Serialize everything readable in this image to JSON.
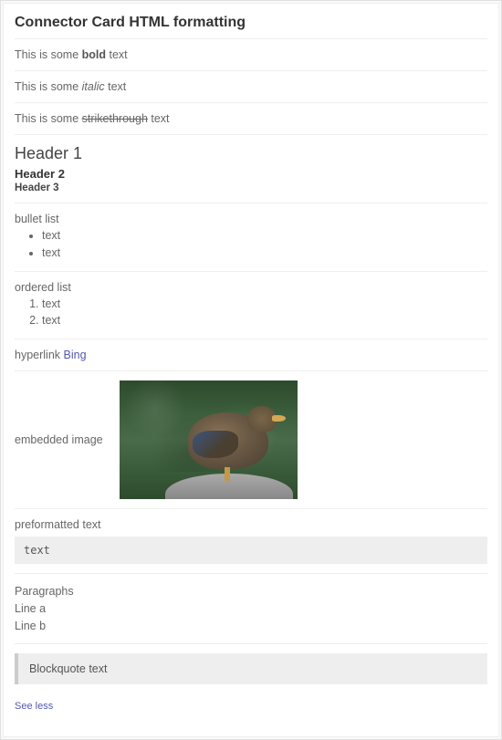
{
  "title": "Connector Card HTML formatting",
  "sections": {
    "bold": {
      "prefix": "This is some ",
      "styled": "bold",
      "suffix": " text"
    },
    "italic": {
      "prefix": "This is some ",
      "styled": "italic",
      "suffix": " text"
    },
    "strike": {
      "prefix": "This is some ",
      "styled": "strikethrough",
      "suffix": " text"
    },
    "headers": {
      "h1": "Header 1",
      "h2": "Header 2",
      "h3": "Header 3"
    },
    "bullet": {
      "label": "bullet list",
      "items": [
        "text",
        "text"
      ]
    },
    "ordered": {
      "label": "ordered list",
      "items": [
        "text",
        "text"
      ]
    },
    "hyperlink": {
      "prefix": "hyperlink ",
      "linkText": "Bing"
    },
    "image": {
      "label": "embedded image"
    },
    "preformatted": {
      "label": "preformatted text",
      "code": "text"
    },
    "paragraphs": {
      "label": "Paragraphs",
      "lines": [
        "Line a",
        "Line b"
      ]
    },
    "blockquote": {
      "text": "Blockquote text"
    }
  },
  "seeLess": "See less"
}
